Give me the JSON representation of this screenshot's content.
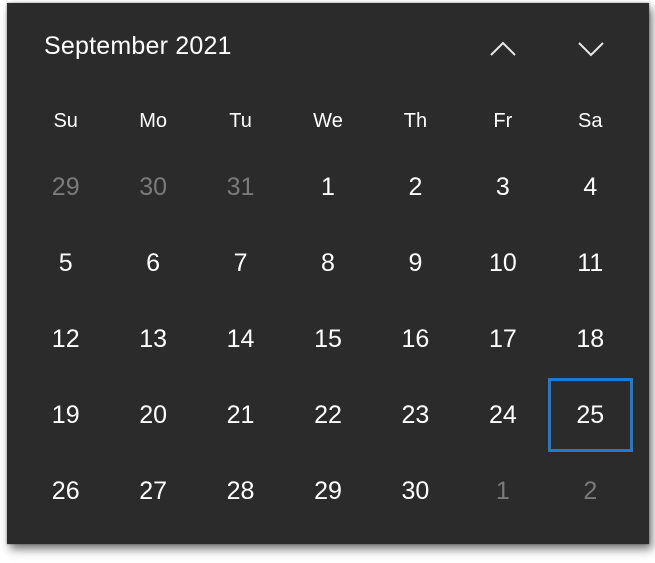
{
  "header": {
    "title": "September 2021",
    "prev_icon": "chevron-up-icon",
    "next_icon": "chevron-down-icon"
  },
  "weekdays": [
    "Su",
    "Mo",
    "Tu",
    "We",
    "Th",
    "Fr",
    "Sa"
  ],
  "days": [
    {
      "label": "29",
      "muted": true
    },
    {
      "label": "30",
      "muted": true
    },
    {
      "label": "31",
      "muted": true
    },
    {
      "label": "1",
      "muted": false
    },
    {
      "label": "2",
      "muted": false
    },
    {
      "label": "3",
      "muted": false
    },
    {
      "label": "4",
      "muted": false
    },
    {
      "label": "5",
      "muted": false
    },
    {
      "label": "6",
      "muted": false
    },
    {
      "label": "7",
      "muted": false
    },
    {
      "label": "8",
      "muted": false
    },
    {
      "label": "9",
      "muted": false
    },
    {
      "label": "10",
      "muted": false
    },
    {
      "label": "11",
      "muted": false
    },
    {
      "label": "12",
      "muted": false
    },
    {
      "label": "13",
      "muted": false
    },
    {
      "label": "14",
      "muted": false
    },
    {
      "label": "15",
      "muted": false
    },
    {
      "label": "16",
      "muted": false
    },
    {
      "label": "17",
      "muted": false
    },
    {
      "label": "18",
      "muted": false
    },
    {
      "label": "19",
      "muted": false
    },
    {
      "label": "20",
      "muted": false
    },
    {
      "label": "21",
      "muted": false
    },
    {
      "label": "22",
      "muted": false
    },
    {
      "label": "23",
      "muted": false
    },
    {
      "label": "24",
      "muted": false
    },
    {
      "label": "25",
      "muted": false,
      "selected": true
    },
    {
      "label": "26",
      "muted": false
    },
    {
      "label": "27",
      "muted": false
    },
    {
      "label": "28",
      "muted": false
    },
    {
      "label": "29",
      "muted": false
    },
    {
      "label": "30",
      "muted": false
    },
    {
      "label": "1",
      "muted": true
    },
    {
      "label": "2",
      "muted": true
    }
  ],
  "colors": {
    "background": "#2b2b2b",
    "text": "#ffffff",
    "muted_text": "#7a7a7a",
    "selection_accent": "#1a7cd8"
  }
}
